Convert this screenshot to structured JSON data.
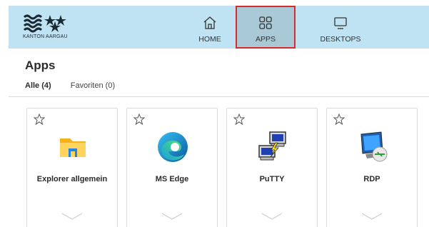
{
  "header": {
    "logo_text": "KANTON AARGAU",
    "nav": [
      {
        "label": "HOME",
        "icon": "home-icon"
      },
      {
        "label": "APPS",
        "icon": "apps-grid-icon"
      },
      {
        "label": "DESKTOPS",
        "icon": "monitor-icon"
      }
    ],
    "colors": {
      "bar": "#bfe3f2",
      "active": "#a9c9d7",
      "highlight_border": "#d62c2c"
    }
  },
  "page": {
    "title": "Apps",
    "tabs": [
      {
        "label": "Alle (4)",
        "active": true
      },
      {
        "label": "Favoriten (0)",
        "active": false
      }
    ]
  },
  "apps": [
    {
      "name": "Explorer allgemein",
      "icon": "folder-icon"
    },
    {
      "name": "MS Edge",
      "icon": "edge-icon"
    },
    {
      "name": "PuTTY",
      "icon": "putty-icon"
    },
    {
      "name": "RDP",
      "icon": "rdp-icon"
    }
  ]
}
